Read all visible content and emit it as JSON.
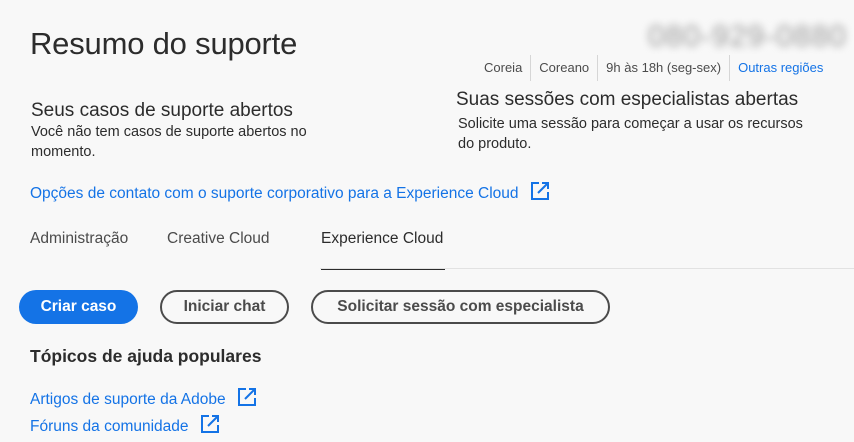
{
  "page": {
    "title": "Resumo do suporte",
    "phone": "080-929-0880"
  },
  "region_bar": {
    "country": "Coreia",
    "language": "Coreano",
    "hours": "9h às 18h (seg-sex)",
    "other_regions": "Outras regiões"
  },
  "open_cases": {
    "heading": "Seus casos de suporte abertos",
    "text": "Você não tem casos de suporte abertos no momento."
  },
  "expert_sessions": {
    "heading": "Suas sessões com especialistas abertas",
    "text": "Solicite uma sessão para começar a usar os recursos do produto."
  },
  "contact_link": "Opções de contato com o suporte corporativo para a Experience Cloud",
  "tabs": [
    {
      "label": "Administração",
      "active": false
    },
    {
      "label": "Creative Cloud",
      "active": false
    },
    {
      "label": "Experience Cloud",
      "active": true
    }
  ],
  "actions": {
    "create_case": "Criar caso",
    "start_chat": "Iniciar chat",
    "request_session": "Solicitar sessão com especialista"
  },
  "help_topics": {
    "heading": "Tópicos de ajuda populares",
    "links": [
      "Artigos de suporte da Adobe",
      "Fóruns da comunidade"
    ]
  },
  "icons": {
    "external_link": "external-link-icon"
  },
  "colors": {
    "accent": "#1473e6",
    "text": "#2c2c2c",
    "background": "#f8f8f8"
  }
}
